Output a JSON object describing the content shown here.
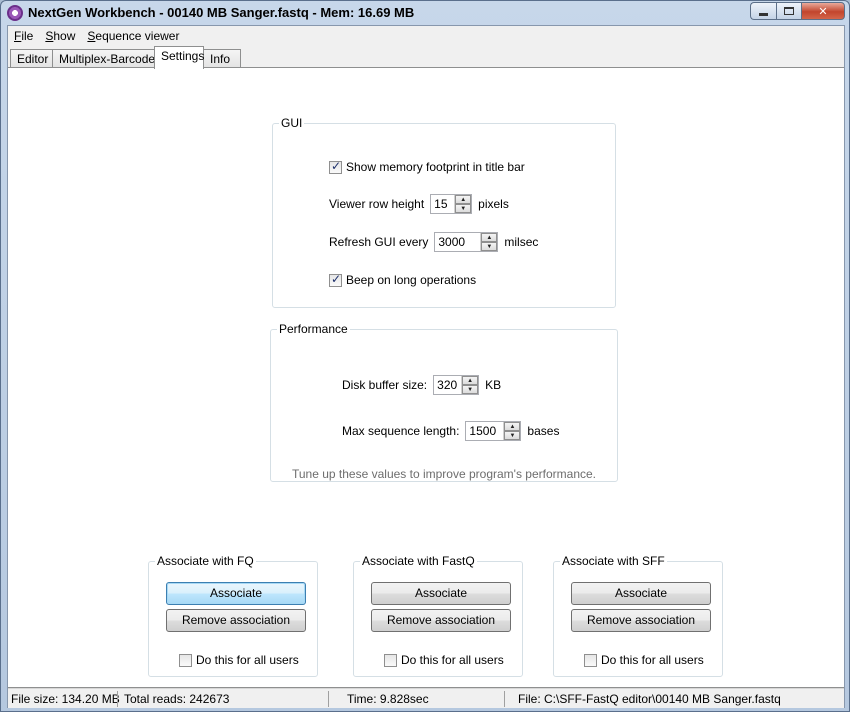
{
  "window": {
    "title": "NextGen Workbench - 00140 MB Sanger.fastq -  Mem: 16.69 MB",
    "close_glyph": "✕"
  },
  "menu": {
    "items": [
      {
        "first": "F",
        "rest": "ile"
      },
      {
        "first": "S",
        "rest": "how"
      },
      {
        "first": "S",
        "rest": "equence viewer"
      }
    ]
  },
  "tabs": [
    {
      "label": "Editor"
    },
    {
      "label": "Multiplex-Barcodes"
    },
    {
      "label": "Settings"
    },
    {
      "label": "Info"
    }
  ],
  "gui": {
    "caption": "GUI",
    "show_memory_label": "Show memory footprint in title bar",
    "show_memory_checked": true,
    "row_height_label": "Viewer row height",
    "row_height_value": "15",
    "row_height_unit": "pixels",
    "refresh_label": "Refresh GUI every",
    "refresh_value": "3000",
    "refresh_unit": "milsec",
    "beep_label": "Beep on long operations",
    "beep_checked": true
  },
  "performance": {
    "caption": "Performance",
    "disk_buffer_label": "Disk buffer size:",
    "disk_buffer_value": "320",
    "disk_buffer_unit": "KB",
    "max_seq_label": "Max sequence length:",
    "max_seq_value": "1500",
    "max_seq_unit": "bases",
    "hint": "Tune up these values to improve program's performance."
  },
  "associations": [
    {
      "caption": "Associate with FQ",
      "associate": "Associate",
      "remove": "Remove association",
      "all_users": "Do this for all users"
    },
    {
      "caption": "Associate with FastQ",
      "associate": "Associate",
      "remove": "Remove association",
      "all_users": "Do this for all users"
    },
    {
      "caption": "Associate with SFF",
      "associate": "Associate",
      "remove": "Remove association",
      "all_users": "Do this for all users"
    }
  ],
  "status": {
    "file_size": "File size: 134.20 MB",
    "total_reads": "Total reads: 242673",
    "time": "Time: 9.828sec",
    "file": "File: C:\\SFF-FastQ editor\\00140 MB Sanger.fastq"
  },
  "icons": {
    "spin_up": "▲",
    "spin_down": "▼"
  }
}
